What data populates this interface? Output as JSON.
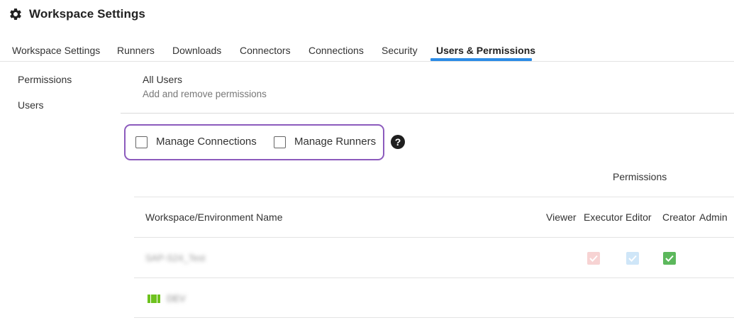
{
  "header": {
    "title": "Workspace Settings",
    "icon": "gear-icon"
  },
  "tabs": [
    {
      "label": "Workspace Settings",
      "active": false
    },
    {
      "label": "Runners",
      "active": false
    },
    {
      "label": "Downloads",
      "active": false
    },
    {
      "label": "Connectors",
      "active": false
    },
    {
      "label": "Connections",
      "active": false
    },
    {
      "label": "Security",
      "active": false
    },
    {
      "label": "Users & Permissions",
      "active": true
    }
  ],
  "sidebar": {
    "items": [
      {
        "label": "Permissions"
      },
      {
        "label": "Users"
      }
    ]
  },
  "section": {
    "title": "All Users",
    "subtitle": "Add and remove permissions"
  },
  "permissions_box": {
    "manage_connections": {
      "label": "Manage Connections",
      "checked": false
    },
    "manage_runners": {
      "label": "Manage Runners",
      "checked": false
    },
    "help_icon": "question-circle-icon",
    "help_glyph": "?"
  },
  "table": {
    "group_heading": "Permissions",
    "columns": {
      "name": "Workspace/Environment Name",
      "viewer": "Viewer",
      "executor": "Executor",
      "editor": "Editor",
      "creator": "Creator",
      "admin": "Admin"
    },
    "rows": [
      {
        "name": "SAP-S24_Test",
        "obscured": true,
        "executor": "checked-faded",
        "editor": "checked-faded",
        "creator": "checked"
      },
      {
        "name": "DEV",
        "obscured": true,
        "icon": "environment-icon"
      }
    ]
  },
  "colors": {
    "accent_tab": "#2b8be6",
    "highlight_border": "#8c5bbd",
    "check_green": "#5cb85c",
    "env_green": "#6ec21f"
  }
}
